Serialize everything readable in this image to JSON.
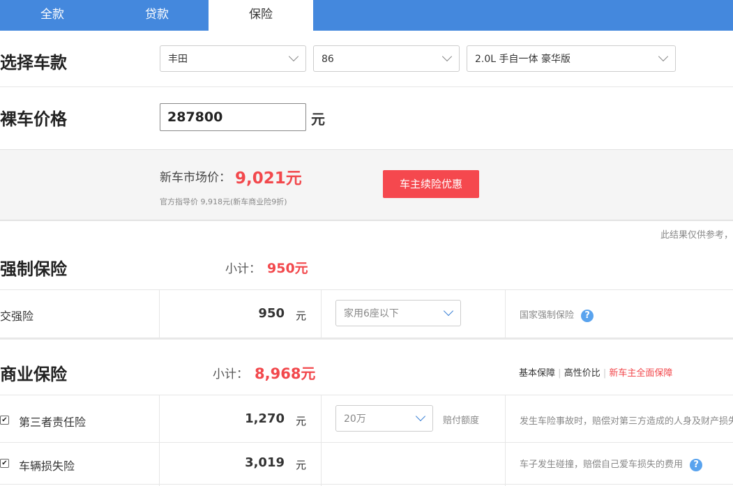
{
  "tabs": [
    "全款",
    "贷款",
    "保险"
  ],
  "select_car": {
    "label": "选择车款",
    "brand": "丰田",
    "series": "86",
    "model": "2.0L 手自一体 豪华版"
  },
  "price": {
    "label": "裸车价格",
    "value": "287800",
    "unit": "元"
  },
  "summary": {
    "market_label": "新车市场价：",
    "market_value": "9,021元",
    "guide_note": "官方指导价 9,918元(新车商业险9折)",
    "renew_button": "车主续险优惠",
    "disclaimer": "此结果仅供参考，"
  },
  "compulsory": {
    "title": "强制保险",
    "subtotal_label": "小计：",
    "subtotal_value": "950元",
    "row": {
      "name": "交强险",
      "amount": "950",
      "unit": "元",
      "option": "家用6座以下",
      "desc": "国家强制保险"
    }
  },
  "commercial": {
    "title": "商业保险",
    "subtotal_label": "小计：",
    "subtotal_value": "8,968元",
    "plans": [
      "基本保障",
      "高性价比",
      "新车主全面保障"
    ],
    "rows": [
      {
        "name": "第三者责任险",
        "amount": "1,270",
        "unit": "元",
        "option": "20万",
        "option_label": "赔付额度",
        "desc": "发生车险事故时，赔偿对第三方造成的人身及财产损失"
      },
      {
        "name": "车辆损失险",
        "amount": "3,019",
        "unit": "元",
        "desc": "车子发生碰撞，赔偿自己爱车损失的费用"
      }
    ]
  },
  "icons": {
    "help": "?",
    "check": "✔"
  },
  "colors": {
    "tab_bg": "#4488dd",
    "accent_red": "#f2484c",
    "help_blue": "#59a3ee"
  }
}
